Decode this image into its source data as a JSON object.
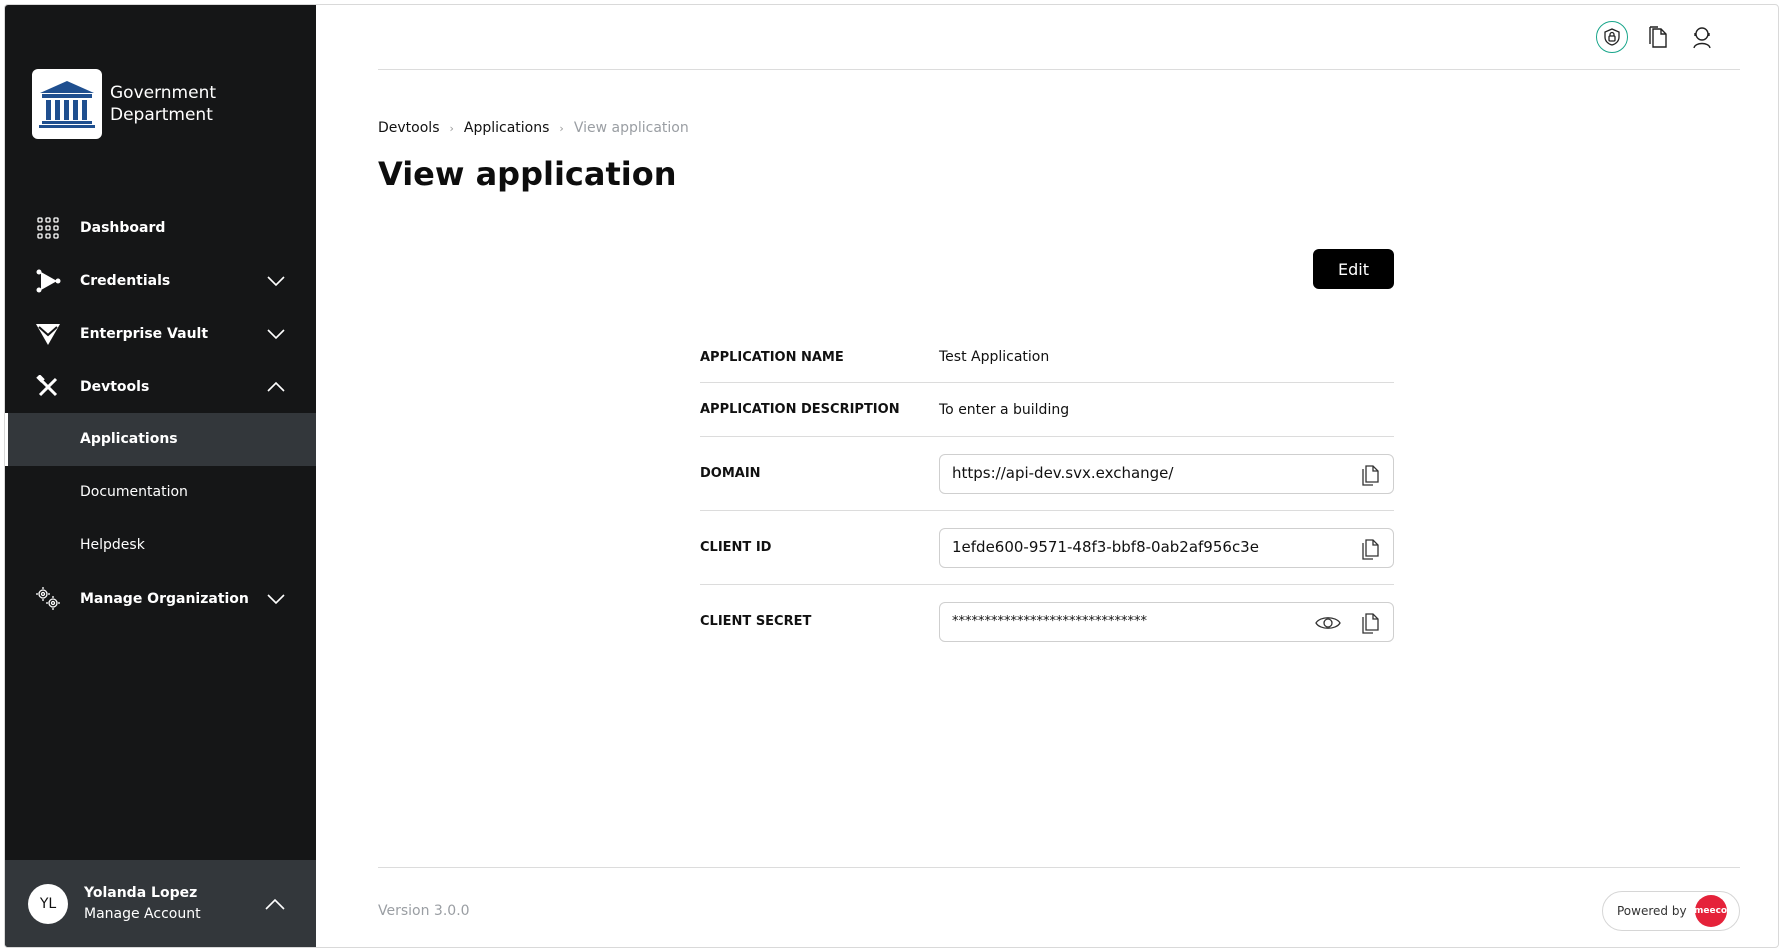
{
  "org": {
    "name_line1": "Government",
    "name_line2": "Department"
  },
  "sidebar": {
    "items": [
      {
        "label": "Dashboard",
        "icon": "grid-icon"
      },
      {
        "label": "Credentials",
        "icon": "credentials-icon",
        "expanded": false
      },
      {
        "label": "Enterprise Vault",
        "icon": "vault-icon",
        "expanded": false
      },
      {
        "label": "Devtools",
        "icon": "tools-icon",
        "expanded": true
      },
      {
        "label": "Manage Organization",
        "icon": "gears-icon",
        "expanded": false
      }
    ],
    "devtools_sub": [
      {
        "label": "Applications",
        "active": true
      },
      {
        "label": "Documentation",
        "active": false
      },
      {
        "label": "Helpdesk",
        "active": false
      }
    ]
  },
  "account": {
    "initials": "YL",
    "name": "Yolanda Lopez",
    "subtitle": "Manage Account"
  },
  "breadcrumb": {
    "item1": "Devtools",
    "item2": "Applications",
    "current": "View application"
  },
  "page": {
    "title": "View application",
    "edit_label": "Edit"
  },
  "details": {
    "app_name_label": "APPLICATION NAME",
    "app_name_value": "Test Application",
    "app_desc_label": "APPLICATION DESCRIPTION",
    "app_desc_value": "To enter a building",
    "domain_label": "DOMAIN",
    "domain_value": "https://api-dev.svx.exchange/",
    "client_id_label": "CLIENT ID",
    "client_id_value": "1efde600-9571-48f3-bbf8-0ab2af956c3e",
    "client_secret_label": "CLIENT SECRET",
    "client_secret_value": "******************************"
  },
  "footer": {
    "version": "Version 3.0.0",
    "powered_by": "Powered by",
    "brand": "meeco"
  },
  "colors": {
    "sidebar_bg": "#151617",
    "active_bg": "#33373b",
    "accent_ring": "#18a58a",
    "brand_red": "#e5223a"
  }
}
